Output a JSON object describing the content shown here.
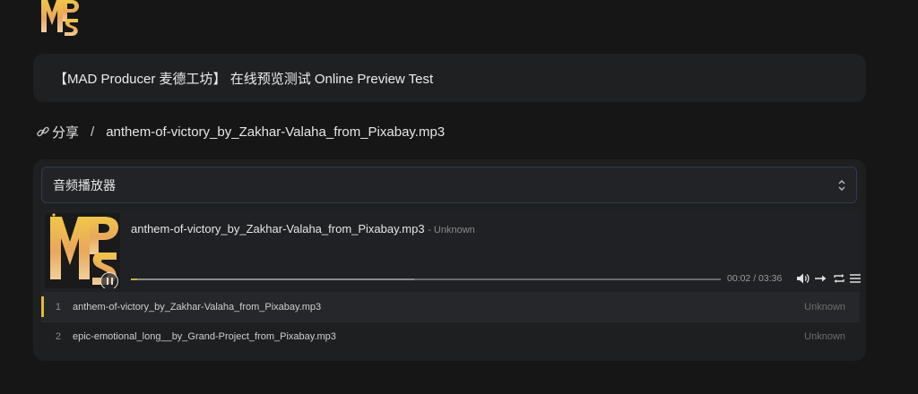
{
  "brand": {
    "accent": "#cfae3d",
    "background": "#161616"
  },
  "title_card": {
    "text": "【MAD Producer 麦德工坊】 在线预览测试 Online Preview Test"
  },
  "breadcrumb": {
    "share_label": "分享",
    "separator": "/",
    "current": "anthem-of-victory_by_Zakhar-Valaha_from_Pixabay.mp3"
  },
  "player_select": {
    "label": "音频播放器"
  },
  "player": {
    "title": "anthem-of-victory_by_Zakhar-Valaha_from_Pixabay.mp3",
    "artist": "- Unknown",
    "current_time": "00:02",
    "duration": "03:36",
    "time_text": "00:02 / 03:36",
    "progress_fraction": 0.01,
    "loaded_fraction": 0.48
  },
  "playlist": [
    {
      "num": "1",
      "name": "anthem-of-victory_by_Zakhar-Valaha_from_Pixabay.mp3",
      "author": "Unknown",
      "active": true
    },
    {
      "num": "2",
      "name": "epic-emotional_long__by_Grand-Project_from_Pixabay.mp3",
      "author": "Unknown",
      "active": false
    }
  ]
}
